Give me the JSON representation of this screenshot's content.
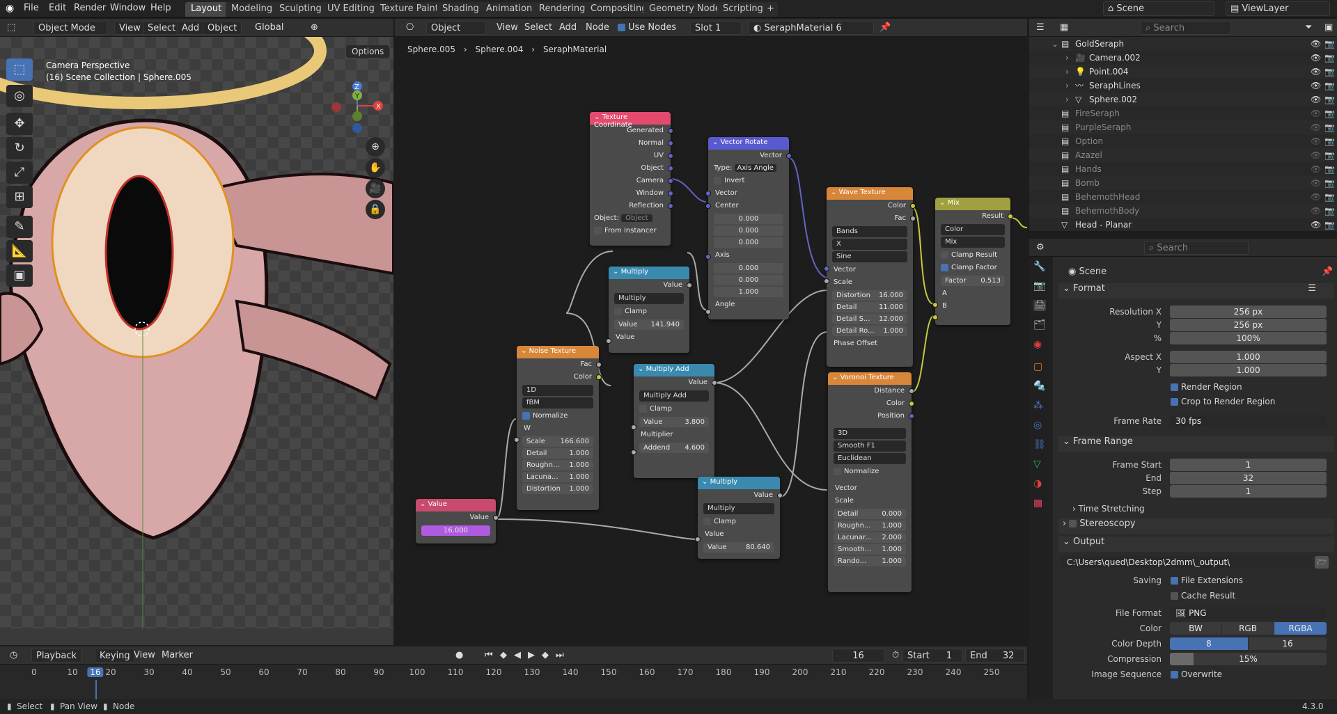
{
  "topbar": {
    "menus": [
      "File",
      "Edit",
      "Render",
      "Window",
      "Help"
    ],
    "workspaces": [
      "Layout",
      "Modeling",
      "Sculpting",
      "UV Editing",
      "Texture Paint",
      "Shading",
      "Animation",
      "Rendering",
      "Compositing",
      "Geometry Nodes",
      "Scripting"
    ],
    "active_workspace": "Layout",
    "scene": "Scene",
    "view_layer": "ViewLayer"
  },
  "viewport": {
    "mode": "Object Mode",
    "menus": [
      "View",
      "Select",
      "Add",
      "Object"
    ],
    "transform": "Global",
    "options": "Options",
    "title": "Camera Perspective",
    "subtitle": "(16) Scene Collection | Sphere.005",
    "gizmo_axes": [
      "Z",
      "Y",
      "X"
    ]
  },
  "node_editor": {
    "editor_type": "Object",
    "menus": [
      "View",
      "Select",
      "Add",
      "Node"
    ],
    "use_nodes": "Use Nodes",
    "slot": "Slot 1",
    "material": "SeraphMaterial",
    "users": "6",
    "breadcrumbs": [
      "Sphere.005",
      "Sphere.004",
      "SeraphMaterial"
    ],
    "nodes": {
      "texcoord": {
        "title": "Texture Coordinate",
        "outputs": [
          "Generated",
          "Normal",
          "UV",
          "Object",
          "Camera",
          "Window",
          "Reflection"
        ],
        "object_label": "Object:",
        "object_field": "Object",
        "from_instancer": "From Instancer"
      },
      "vecrot": {
        "title": "Vector Rotate",
        "out": "Vector",
        "type_label": "Type:",
        "type": "Axis Angle",
        "invert": "Invert",
        "vector": "Vector",
        "center": "Center",
        "center_vals": [
          "0.000",
          "0.000",
          "0.000"
        ],
        "axis": "Axis",
        "axis_vals": [
          "0.000",
          "0.000",
          "1.000"
        ],
        "angle": "Angle"
      },
      "wave": {
        "title": "Wave Texture",
        "out_color": "Color",
        "out_fac": "Fac",
        "sel1": "Bands",
        "sel2": "X",
        "sel3": "Sine",
        "in_vector": "Vector",
        "in_scale": "Scale",
        "fields": [
          [
            "Distortion",
            "16.000"
          ],
          [
            "Detail",
            "11.000"
          ],
          [
            "Detail S...",
            "12.000"
          ],
          [
            "Detail Ro...",
            "1.000"
          ]
        ],
        "phase": "Phase Offset"
      },
      "mix": {
        "title": "Mix",
        "out": "Result",
        "sel1": "Color",
        "sel2": "Mix",
        "clamp_result": "Clamp Result",
        "clamp_factor": "Clamp Factor",
        "factor_label": "Factor",
        "factor": "0.513",
        "a": "A",
        "b": "B"
      },
      "mult1": {
        "title": "Multiply",
        "out": "Value",
        "op": "Multiply",
        "clamp": "Clamp",
        "val_label": "Value",
        "val": "141.940",
        "in": "Value"
      },
      "noise": {
        "title": "Noise Texture",
        "out_fac": "Fac",
        "out_color": "Color",
        "sel1": "1D",
        "sel2": "fBM",
        "normalize": "Normalize",
        "w": "W",
        "fields": [
          [
            "Scale",
            "166.600"
          ],
          [
            "Detail",
            "1.000"
          ],
          [
            "Roughn...",
            "1.000"
          ],
          [
            "Lacuna...",
            "1.000"
          ],
          [
            "Distortion",
            "1.000"
          ]
        ]
      },
      "muladd": {
        "title": "Multiply Add",
        "out": "Value",
        "op": "Multiply Add",
        "clamp": "Clamp",
        "value_label": "Value",
        "value": "3.800",
        "multiplier": "Multiplier",
        "addend_label": "Addend",
        "addend": "4.600"
      },
      "voronoi": {
        "title": "Voronoi Texture",
        "outputs": [
          "Distance",
          "Color",
          "Position"
        ],
        "sel1": "3D",
        "sel2": "Smooth F1",
        "sel3": "Euclidean",
        "normalize": "Normalize",
        "vector": "Vector",
        "scale": "Scale",
        "fields": [
          [
            "Detail",
            "0.000"
          ],
          [
            "Roughn...",
            "1.000"
          ],
          [
            "Lacunar...",
            "2.000"
          ],
          [
            "Smooth...",
            "1.000"
          ],
          [
            "Rando...",
            "1.000"
          ]
        ]
      },
      "value": {
        "title": "Value",
        "out": "Value",
        "val": "16.000"
      },
      "mult2": {
        "title": "Multiply",
        "out": "Value",
        "op": "Multiply",
        "clamp": "Clamp",
        "in": "Value",
        "val_label": "Value",
        "val": "80.640"
      }
    }
  },
  "outliner": {
    "search_placeholder": "Search",
    "items": [
      {
        "name": "GoldSeraph",
        "level": 0
      },
      {
        "name": "Camera.002",
        "level": 1
      },
      {
        "name": "Point.004",
        "level": 1
      },
      {
        "name": "SeraphLines",
        "level": 1
      },
      {
        "name": "Sphere.002",
        "level": 1
      },
      {
        "name": "FireSeraph",
        "level": 0
      },
      {
        "name": "PurpleSeraph",
        "level": 0
      },
      {
        "name": "Option",
        "level": 0
      },
      {
        "name": "Azazel",
        "level": 0
      },
      {
        "name": "Hands",
        "level": 0
      },
      {
        "name": "Bomb",
        "level": 0
      },
      {
        "name": "BehemothHead",
        "level": 0
      },
      {
        "name": "BehemothBody",
        "level": 0
      },
      {
        "name": "Head - Planar",
        "level": 0
      }
    ]
  },
  "properties": {
    "search_placeholder": "Search",
    "context": "Scene",
    "format": {
      "title": "Format",
      "res_x_label": "Resolution X",
      "res_x": "256 px",
      "y_label": "Y",
      "res_y": "256 px",
      "pct_label": "%",
      "pct": "100%",
      "aspect_x_label": "Aspect X",
      "aspect_x": "1.000",
      "aspect_y_label": "Y",
      "aspect_y": "1.000",
      "render_region": "Render Region",
      "crop": "Crop to Render Region",
      "fps_label": "Frame Rate",
      "fps": "30 fps"
    },
    "frame_range": {
      "title": "Frame Range",
      "start_label": "Frame Start",
      "start": "1",
      "end_label": "End",
      "end": "32",
      "step_label": "Step",
      "step": "1",
      "time_stretching": "Time Stretching"
    },
    "stereoscopy": "Stereoscopy",
    "output": {
      "title": "Output",
      "path": "C:\\Users\\qued\\Desktop\\2dmm\\_output\\",
      "saving_label": "Saving",
      "file_ext": "File Extensions",
      "cache": "Cache Result",
      "format_label": "File Format",
      "format": "PNG",
      "color_label": "Color",
      "color_opts": [
        "BW",
        "RGB",
        "RGBA"
      ],
      "depth_label": "Color Depth",
      "depth_opts": [
        "8",
        "16"
      ],
      "compression_label": "Compression",
      "compression": "15%",
      "compression_value": 0.15,
      "seq_label": "Image Sequence",
      "overwrite": "Overwrite"
    }
  },
  "timeline": {
    "menus": [
      "Playback",
      "Keying",
      "View",
      "Marker"
    ],
    "current_frame": "16",
    "start_label": "Start",
    "start": "1",
    "end_label": "End",
    "end": "32",
    "ticks": [
      "0",
      "10",
      "16",
      "20",
      "30",
      "40",
      "50",
      "60",
      "70",
      "80",
      "90",
      "100",
      "110",
      "120",
      "130",
      "140",
      "150",
      "160",
      "170",
      "180",
      "190",
      "200",
      "210",
      "220",
      "230",
      "240",
      "250"
    ]
  },
  "statusbar": {
    "select": "Select",
    "pan": "Pan View",
    "node": "Node",
    "version": "4.3.0"
  },
  "colors": {
    "accent": "#4772b3",
    "active_tab": "#474747",
    "purple_value": "#b05ae0",
    "wave_header": "#d8863a",
    "node_bg": "#4a4a4a",
    "halo": "#e9c978",
    "eye_rim": "#e09020"
  }
}
